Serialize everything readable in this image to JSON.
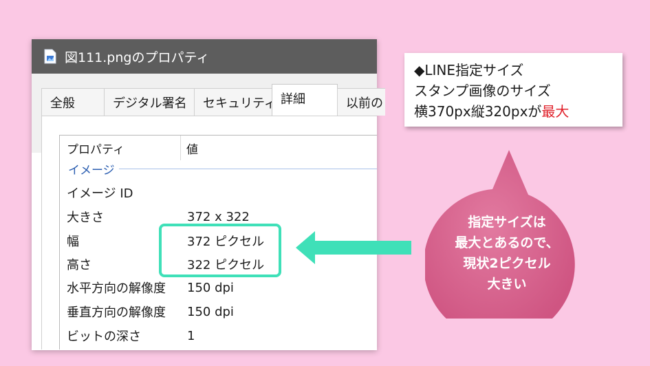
{
  "window": {
    "title": "図111.pngのプロパティ",
    "tabs": [
      {
        "label": "全般"
      },
      {
        "label": "デジタル署名"
      },
      {
        "label": "セキュリティ"
      },
      {
        "label": "詳細",
        "active": true
      },
      {
        "label": "以前の"
      }
    ],
    "columns": {
      "property": "プロパティ",
      "value": "値"
    },
    "group": "イメージ",
    "rows": [
      {
        "name": "イメージ ID",
        "value": ""
      },
      {
        "name": "大きさ",
        "value": "372 x 322"
      },
      {
        "name": "幅",
        "value": "372 ピクセル"
      },
      {
        "name": "高さ",
        "value": "322 ピクセル"
      },
      {
        "name": "水平方向の解像度",
        "value": "150 dpi"
      },
      {
        "name": "垂直方向の解像度",
        "value": "150 dpi"
      },
      {
        "name": "ビットの深さ",
        "value": "1"
      }
    ]
  },
  "callout": {
    "line1": "◆LINE指定サイズ",
    "line2": "スタンプ画像のサイズ",
    "line3_prefix": "横370px縦320pxが",
    "line3_emphasis": "最大"
  },
  "bubble": {
    "lines": [
      "指定サイズは",
      "最大とあるので、",
      "現状2ピクセル",
      "大きい"
    ]
  },
  "colors": {
    "background": "#fbc8e4",
    "titlebar": "#5d5d5d",
    "highlight": "#3fe0b8",
    "bubble": "#d6628a",
    "emphasis": "#e0202a"
  }
}
